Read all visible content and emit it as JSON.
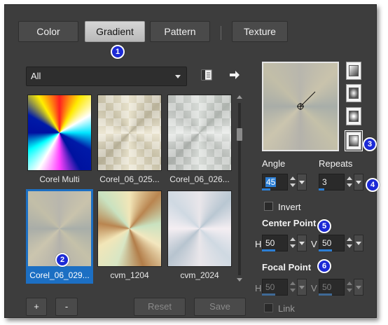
{
  "tabs": [
    {
      "label": "Color",
      "active": false
    },
    {
      "label": "Gradient",
      "active": true
    },
    {
      "label": "Pattern",
      "active": false
    },
    {
      "label": "Texture",
      "active": false
    }
  ],
  "badges": [
    "1",
    "2",
    "3",
    "4",
    "5",
    "6"
  ],
  "category": {
    "selected": "All"
  },
  "icons": {
    "library": "library-icon",
    "export": "arrow-right-icon"
  },
  "gradients": [
    {
      "name": "Corel Multi",
      "selected": false
    },
    {
      "name": "Corel_06_025...",
      "selected": false
    },
    {
      "name": "Corel_06_026...",
      "selected": false
    },
    {
      "name": "Corel_06_029...",
      "selected": true
    },
    {
      "name": "cvm_1204",
      "selected": false
    },
    {
      "name": "cvm_2024",
      "selected": false
    }
  ],
  "buttons": {
    "add": "+",
    "remove": "-",
    "reset": "Reset",
    "save": "Save"
  },
  "settings": {
    "angle_label": "Angle",
    "angle_value": "45",
    "repeats_label": "Repeats",
    "repeats_value": "3",
    "invert_label": "Invert",
    "invert_checked": false,
    "center_point_label": "Center Point",
    "center_h_label": "H",
    "center_h_value": "50",
    "center_v_label": "V",
    "center_v_value": "50",
    "focal_point_label": "Focal Point",
    "focal_h_label": "H",
    "focal_h_value": "50",
    "focal_v_label": "V",
    "focal_v_value": "50",
    "link_label": "Link",
    "link_checked": false
  },
  "gradient_types": [
    "linear",
    "rectangular",
    "radial",
    "sunburst"
  ],
  "colors": {
    "accent": "#2c7fd6",
    "selection": "#1c6fc3",
    "badge": "#1c2ad6",
    "panel": "#3d3d3d"
  }
}
